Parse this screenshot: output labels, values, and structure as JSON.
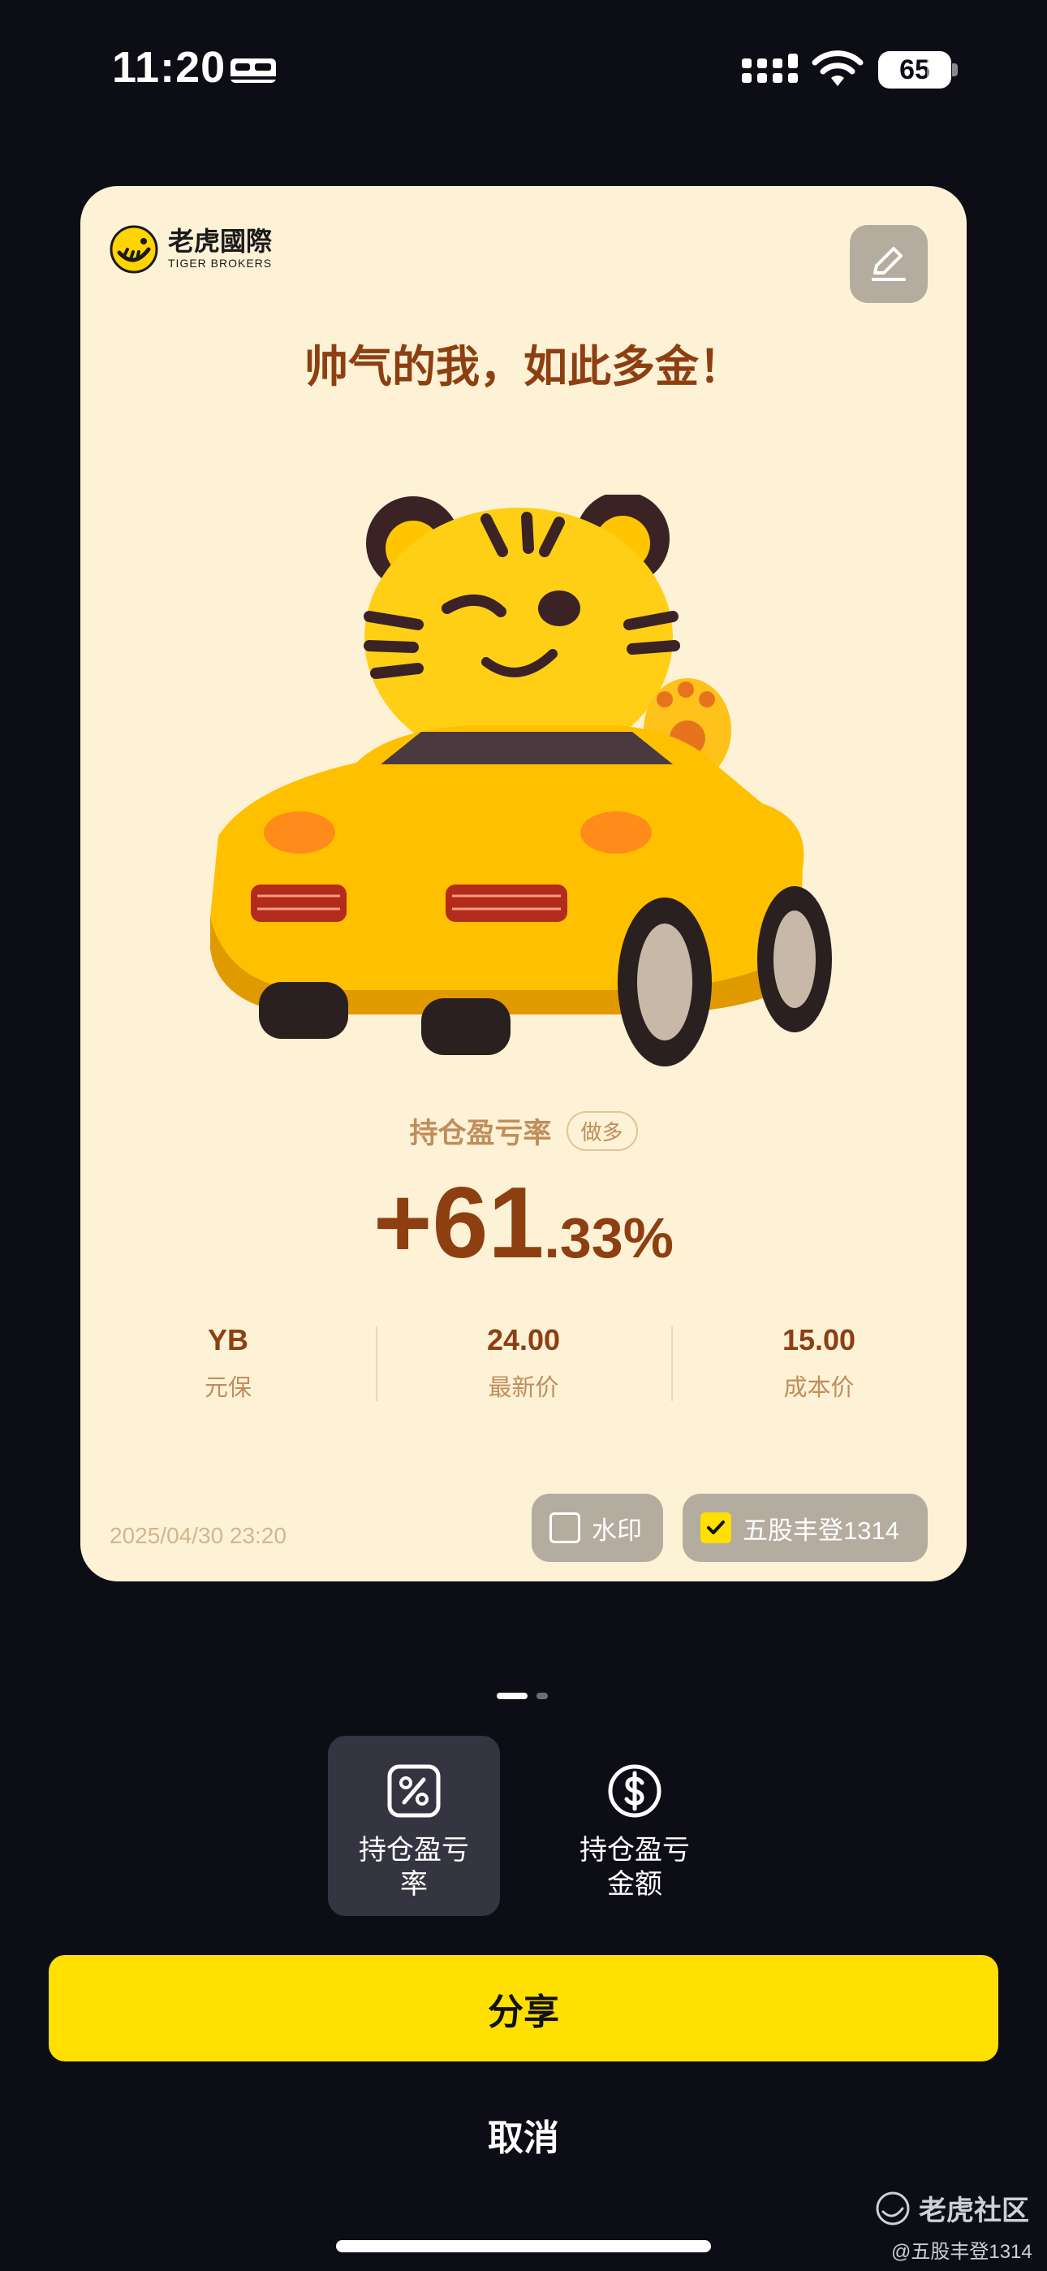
{
  "status_bar": {
    "time": "11:20",
    "battery": "65"
  },
  "card": {
    "brand_cn": "老虎國際",
    "brand_en": "TIGER BROKERS",
    "headline": "帅气的我，如此多金！",
    "metric_label": "持仓盈亏率",
    "side_badge": "做多",
    "metric_value_main": "+61",
    "metric_value_decimal": ".33%",
    "stats": [
      {
        "value": "YB",
        "label": "元保"
      },
      {
        "value": "24.00",
        "label": "最新价"
      },
      {
        "value": "15.00",
        "label": "成本价"
      }
    ],
    "timestamp": "2025/04/30 23:20",
    "watermark_option": {
      "label": "水印",
      "checked": false
    },
    "username_option": {
      "label": "五股丰登1314",
      "checked": true
    }
  },
  "pager": {
    "pages": 2,
    "active": 1
  },
  "share_options": [
    {
      "label": "持仓盈亏\n率",
      "icon": "percent-icon",
      "selected": true
    },
    {
      "label": "持仓盈亏\n金额",
      "icon": "dollar-icon",
      "selected": false
    }
  ],
  "share_button": "分享",
  "cancel_button": "取消",
  "watermark": {
    "title": "老虎社区",
    "user": "@五股丰登1314"
  },
  "colors": {
    "accent": "#ffe000",
    "card_bg": "#fdf2d6",
    "headline": "#8e3f12",
    "background": "#0d0d16"
  }
}
